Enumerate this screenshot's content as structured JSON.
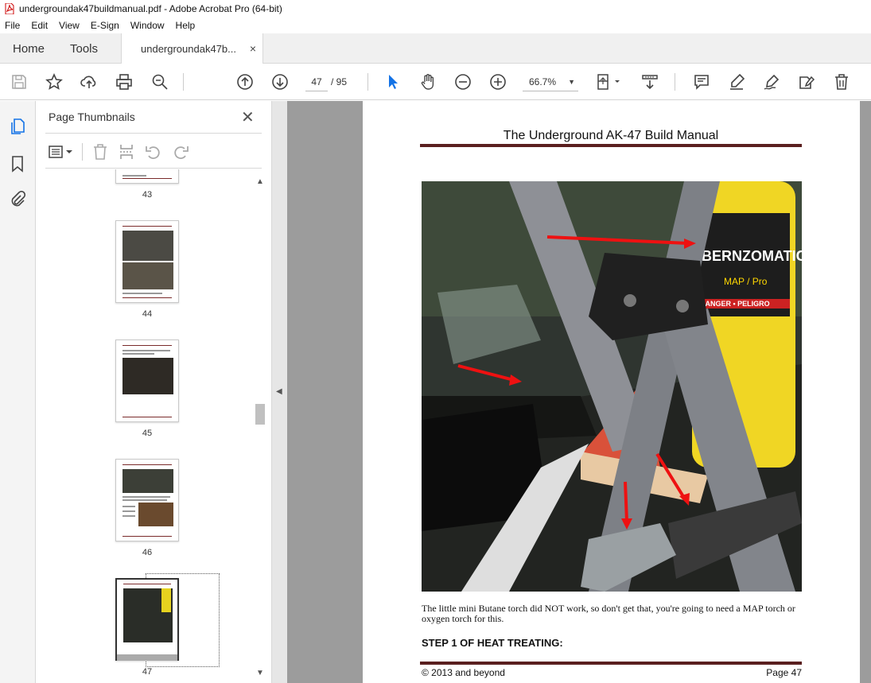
{
  "window": {
    "title": "undergroundak47buildmanual.pdf - Adobe Acrobat Pro (64-bit)"
  },
  "menu": [
    "File",
    "Edit",
    "View",
    "E-Sign",
    "Window",
    "Help"
  ],
  "tabs": {
    "home": "Home",
    "tools": "Tools",
    "document": "undergroundak47b...",
    "close": "×"
  },
  "toolbar": {
    "current_page": "47",
    "total_pages": "/ 95",
    "zoom": "66.7%",
    "icons": [
      "save-icon",
      "star-icon",
      "upload-icon",
      "print-icon",
      "zoom-search-icon",
      "page-up-icon",
      "page-down-icon",
      "select-cursor-icon",
      "hand-icon",
      "zoom-out-icon",
      "zoom-in-icon",
      "fit-page-icon",
      "scroll-mode-icon",
      "comment-icon",
      "highlight-icon",
      "sign-icon",
      "fill-sign-icon",
      "trash-icon"
    ]
  },
  "left_rail": {
    "icons": [
      "pages-icon",
      "bookmark-icon",
      "attachment-icon"
    ]
  },
  "thumbnail_panel": {
    "title": "Page Thumbnails",
    "close": "✕",
    "thumbnails": [
      {
        "page": "43"
      },
      {
        "page": "44"
      },
      {
        "page": "45"
      },
      {
        "page": "46"
      },
      {
        "page": "47",
        "selected": true
      }
    ]
  },
  "document": {
    "header": "The Underground AK-47 Build Manual",
    "caption": "The little mini Butane torch did NOT work, so don't get that, you're going to need a MAP torch or oxygen torch for this.",
    "heading": "STEP 1 OF HEAT TREATING:",
    "footer_left": "© 2013 and beyond",
    "footer_right": "Page 47",
    "photo_labels": {
      "cylinder_brand": "BERNZOMATIC",
      "cylinder_band": "MAP / Pro",
      "cylinder_warning": "DANGER • PELIGRO"
    }
  }
}
